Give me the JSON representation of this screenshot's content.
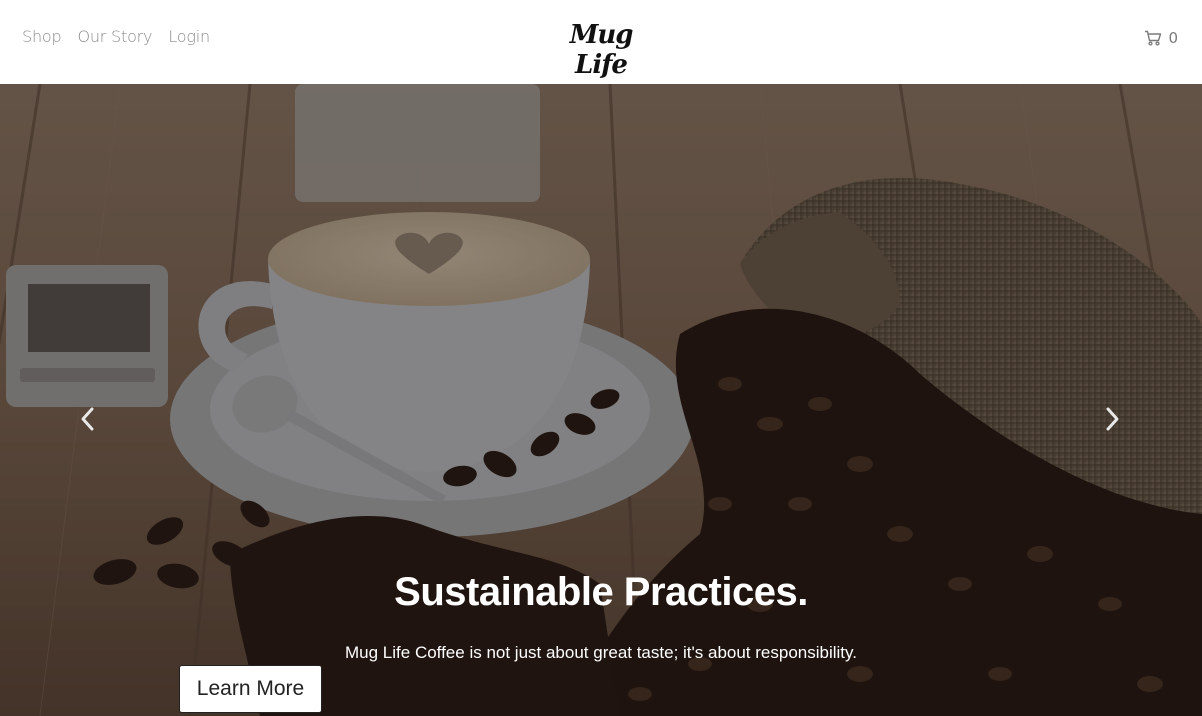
{
  "header": {
    "nav": [
      {
        "label": "Shop"
      },
      {
        "label": "Our Story"
      },
      {
        "label": "Login"
      }
    ],
    "logo": "Mug Life",
    "cart": {
      "icon": "cart-icon",
      "count": "0"
    }
  },
  "hero": {
    "headline": "Sustainable Practices.",
    "subline": "Mug Life Coffee is not just about great taste; it's about responsibility.",
    "cta_label": "Learn More",
    "prev_icon": "chevron-left-icon",
    "next_icon": "chevron-right-icon"
  }
}
